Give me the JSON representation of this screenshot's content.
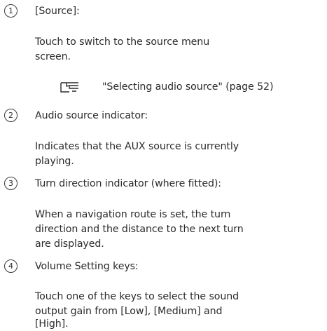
{
  "items": [
    {
      "number": "1",
      "heading": "[Source]:",
      "body_lines": [
        "Touch to switch to the source menu",
        "screen."
      ],
      "reference": "\"Selecting audio source\" (page 52)",
      "reference_icon": "reference-hand-icon"
    },
    {
      "number": "2",
      "heading": "Audio source indicator:",
      "body_lines": [
        "Indicates that the AUX source is currently",
        "playing."
      ]
    },
    {
      "number": "3",
      "heading": "Turn direction indicator (where fitted):",
      "body_lines": [
        "When a navigation route is set, the turn",
        "direction and the distance to the next turn",
        "are displayed."
      ]
    },
    {
      "number": "4",
      "heading": "Volume Setting keys:",
      "body_lines": [
        "Touch one of the keys to select the sound",
        "output gain from [Low], [Medium] and",
        "[High]."
      ]
    }
  ]
}
